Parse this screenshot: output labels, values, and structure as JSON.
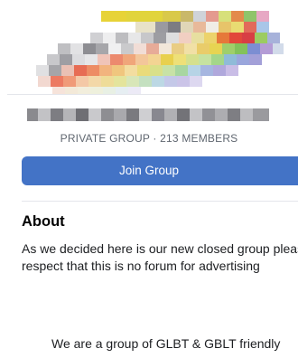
{
  "group": {
    "meta": "PRIVATE GROUP · 213 MEMBERS",
    "join_label": "Join Group"
  },
  "about": {
    "title": "About",
    "description": "As we decided here is our new closed group please respect that this is no forum for advertising",
    "intro": "We are a group of GLBT & GBLT friendly"
  },
  "colors": {
    "accent": "#4373c6",
    "meta_text": "#606770",
    "divider": "#e4e6eb"
  }
}
